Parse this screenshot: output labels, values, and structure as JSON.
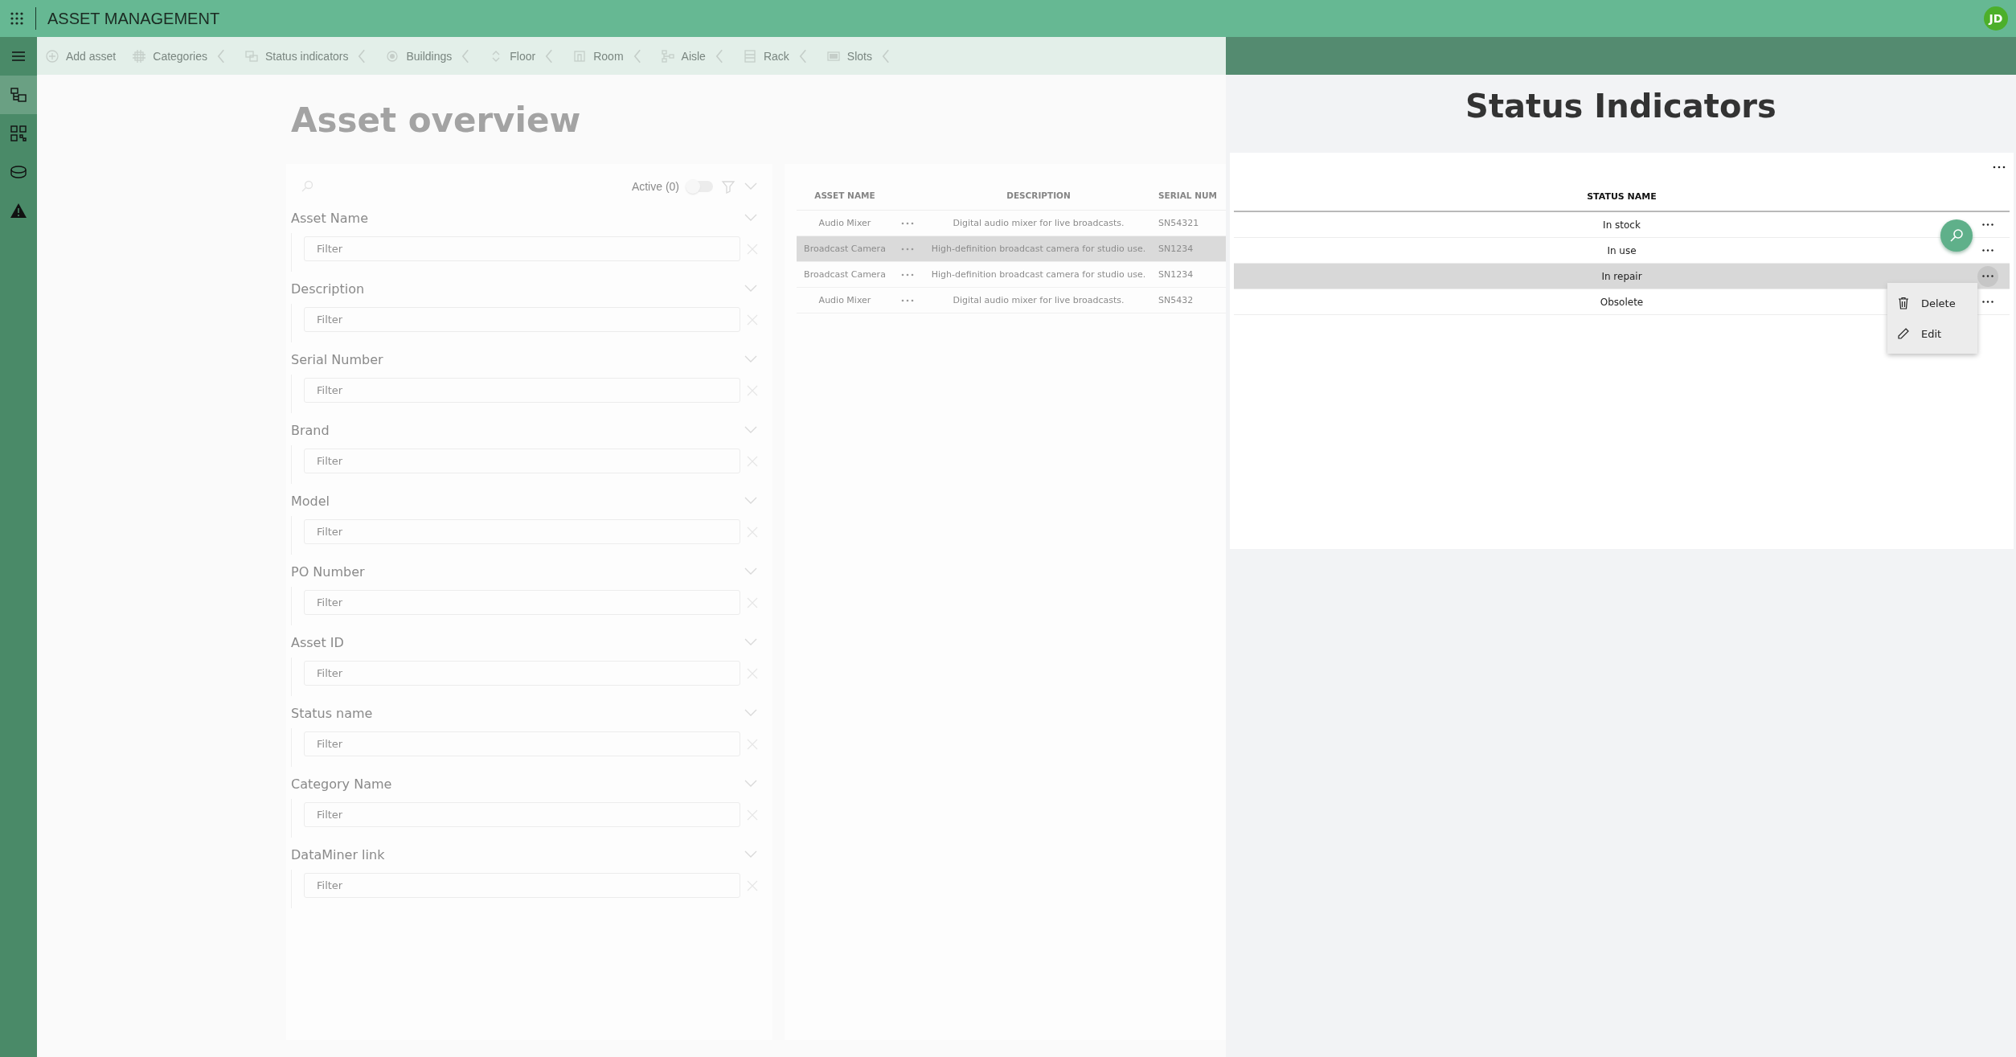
{
  "app": {
    "title": "ASSET MANAGEMENT",
    "user_initials": "JD"
  },
  "rail": [
    {
      "kind": "menu",
      "selected": false
    },
    {
      "kind": "tree",
      "selected": true
    },
    {
      "kind": "qr",
      "selected": false
    },
    {
      "kind": "disk",
      "selected": false
    },
    {
      "kind": "warning",
      "selected": false
    }
  ],
  "toolbar": [
    {
      "kind": "add",
      "label": "Add asset",
      "expandable": false
    },
    {
      "kind": "categories",
      "label": "Categories",
      "expandable": true
    },
    {
      "kind": "status",
      "label": "Status indicators",
      "expandable": true
    },
    {
      "kind": "buildings",
      "label": "Buildings",
      "expandable": true
    },
    {
      "kind": "floor",
      "label": "Floor",
      "expandable": true
    },
    {
      "kind": "room",
      "label": "Room",
      "expandable": true
    },
    {
      "kind": "aisle",
      "label": "Aisle",
      "expandable": true
    },
    {
      "kind": "rack",
      "label": "Rack",
      "expandable": true
    },
    {
      "kind": "slots",
      "label": "Slots",
      "expandable": true
    }
  ],
  "overview": {
    "title": "Asset overview",
    "filters": {
      "active_label": "Active (0)",
      "active_on": false,
      "fields": [
        {
          "label": "Asset Name",
          "placeholder": "Filter"
        },
        {
          "label": "Description",
          "placeholder": "Filter"
        },
        {
          "label": "Serial Number",
          "placeholder": "Filter"
        },
        {
          "label": "Brand",
          "placeholder": "Filter"
        },
        {
          "label": "Model",
          "placeholder": "Filter"
        },
        {
          "label": "PO Number",
          "placeholder": "Filter"
        },
        {
          "label": "Asset ID",
          "placeholder": "Filter"
        },
        {
          "label": "Status name",
          "placeholder": "Filter"
        },
        {
          "label": "Category Name",
          "placeholder": "Filter"
        },
        {
          "label": "DataMiner link",
          "placeholder": "Filter"
        }
      ]
    },
    "table": {
      "columns": [
        "ASSET NAME",
        "DESCRIPTION",
        "SERIAL NUM"
      ],
      "rows": [
        {
          "cells": [
            "Audio Mixer",
            "Digital audio mixer for live broadcasts.",
            "SN54321"
          ],
          "highlighted": false
        },
        {
          "cells": [
            "Broadcast Camera",
            "High-definition broadcast camera for studio use.",
            "SN1234"
          ],
          "highlighted": true
        },
        {
          "cells": [
            "Broadcast Camera",
            "High-definition broadcast camera for studio use.",
            "SN1234"
          ],
          "highlighted": false
        },
        {
          "cells": [
            "Audio Mixer",
            "Digital audio mixer for live broadcasts.",
            "SN5432"
          ],
          "highlighted": false
        }
      ]
    }
  },
  "panel": {
    "title": "Status Indicators",
    "table": {
      "columns": [
        "STATUS NAME"
      ],
      "rows": [
        {
          "name": "In stock",
          "selected": false
        },
        {
          "name": "In use",
          "selected": false
        },
        {
          "name": "In repair",
          "selected": true
        },
        {
          "name": "Obsolete",
          "selected": false
        }
      ]
    },
    "context_menu": {
      "items": [
        {
          "kind": "delete",
          "label": "Delete"
        },
        {
          "kind": "edit",
          "label": "Edit"
        }
      ]
    }
  }
}
